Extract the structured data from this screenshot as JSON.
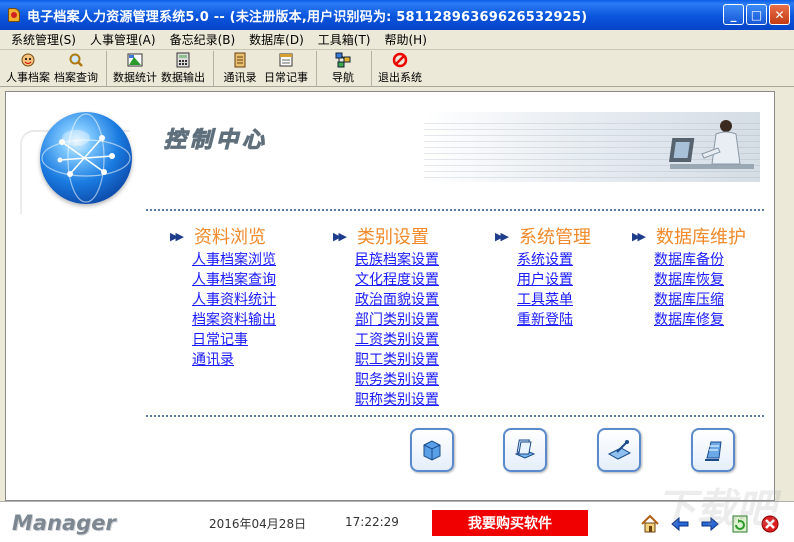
{
  "window": {
    "title": "电子档案人力资源管理系统5.0 -- (未注册版本,用户识别码为: 58112896369626532925)",
    "minimize": "_",
    "maximize": "□",
    "close": "✕"
  },
  "menu": [
    "系统管理(S)",
    "人事管理(A)",
    "备忘纪录(B)",
    "数据库(D)",
    "工具箱(T)",
    "帮助(H)"
  ],
  "toolbar": {
    "groups": [
      [
        {
          "label": "人事档案",
          "icon": "face-icon"
        },
        {
          "label": "档案查询",
          "icon": "magnifier-icon"
        }
      ],
      [
        {
          "label": "数据统计",
          "icon": "chart-icon"
        },
        {
          "label": "数据输出",
          "icon": "calculator-icon"
        }
      ],
      [
        {
          "label": "通讯录",
          "icon": "address-book-icon"
        },
        {
          "label": "日常记事",
          "icon": "notepad-icon"
        }
      ],
      [
        {
          "label": "导航",
          "icon": "navigation-icon"
        }
      ],
      [
        {
          "label": "退出系统",
          "icon": "exit-icon"
        }
      ]
    ]
  },
  "control_center": {
    "title": "控制中心"
  },
  "columns": [
    {
      "title": "资料浏览",
      "links": [
        "人事档案浏览",
        "人事档案查询",
        "人事资料统计",
        "档案资料输出",
        "日常记事",
        "通讯录"
      ]
    },
    {
      "title": "类别设置",
      "links": [
        "民族档案设置",
        "文化程度设置",
        "政治面貌设置",
        "部门类别设置",
        "工资类别设置",
        "职工类别设置",
        "职务类别设置",
        "职称类别设置"
      ]
    },
    {
      "title": "系统管理",
      "links": [
        "系统设置",
        "用户设置",
        "工具菜单",
        "重新登陆"
      ]
    },
    {
      "title": "数据库维护",
      "links": [
        "数据库备份",
        "数据库恢复",
        "数据库压缩",
        "数据库修复"
      ]
    }
  ],
  "status": {
    "brand": "Manager",
    "date": "2016年04月28日",
    "time": "17:22:29",
    "buy_label": "我要购买软件"
  },
  "watermark": "下载吧",
  "colors": {
    "titlebar": "#0a55dc",
    "column_title": "#f08a2a",
    "link": "#1a1aff",
    "buy_button": "#f00000"
  }
}
